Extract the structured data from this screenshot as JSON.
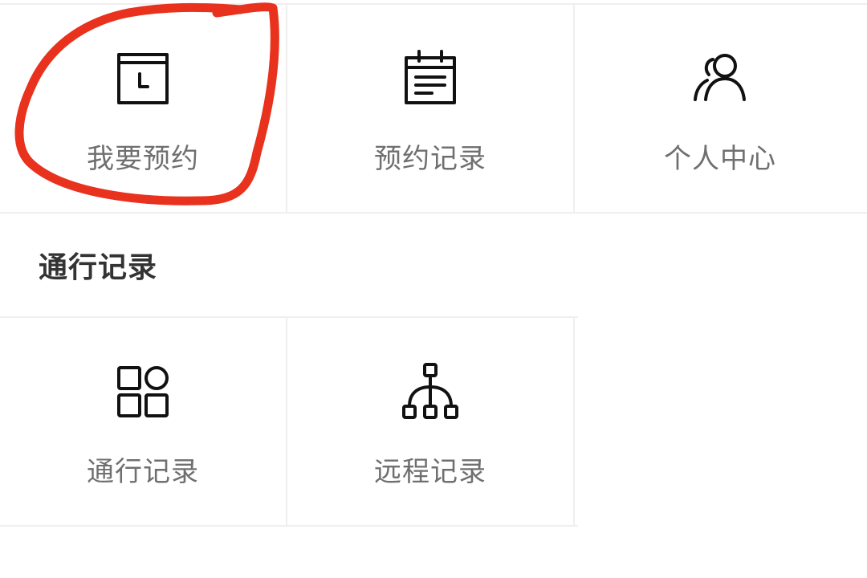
{
  "menu_top": {
    "items": [
      {
        "label": "我要预约",
        "icon": "clock-icon"
      },
      {
        "label": "预约记录",
        "icon": "notepad-icon"
      },
      {
        "label": "个人中心",
        "icon": "users-icon"
      }
    ]
  },
  "section": {
    "title": "通行记录"
  },
  "menu_bottom": {
    "items": [
      {
        "label": "通行记录",
        "icon": "grid-icon"
      },
      {
        "label": "远程记录",
        "icon": "network-icon"
      }
    ]
  },
  "colors": {
    "annotation": "#e8321e",
    "label": "#6f6f6f",
    "divider": "#efefef"
  }
}
